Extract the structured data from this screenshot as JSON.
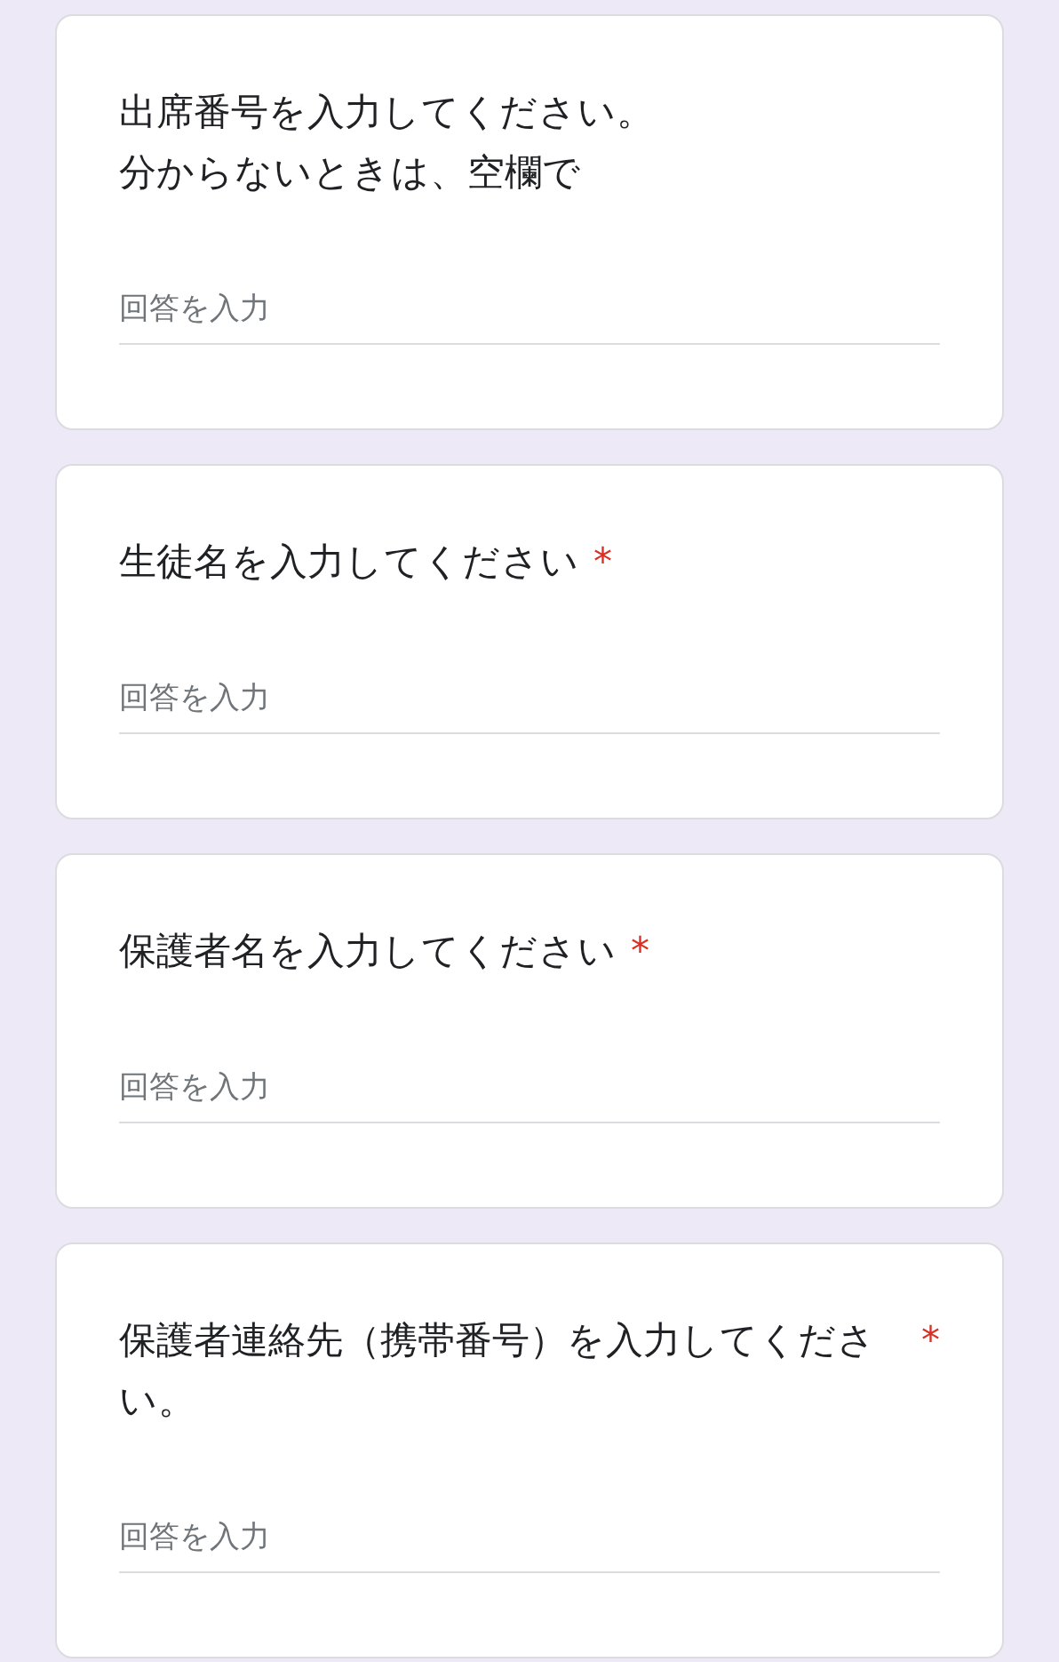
{
  "questions": [
    {
      "title_lines": [
        "出席番号を入力してください。",
        "分からないときは、空欄で"
      ],
      "placeholder": "回答を入力"
    },
    {
      "title": "生徒名を入力してください",
      "required_mark": "*",
      "placeholder": "回答を入力"
    },
    {
      "title": "保護者名を入力してください",
      "required_mark": "*",
      "placeholder": "回答を入力"
    },
    {
      "title": "保護者連絡先（携帯番号）を入力してください。",
      "required_mark": "*",
      "placeholder": "回答を入力"
    }
  ]
}
